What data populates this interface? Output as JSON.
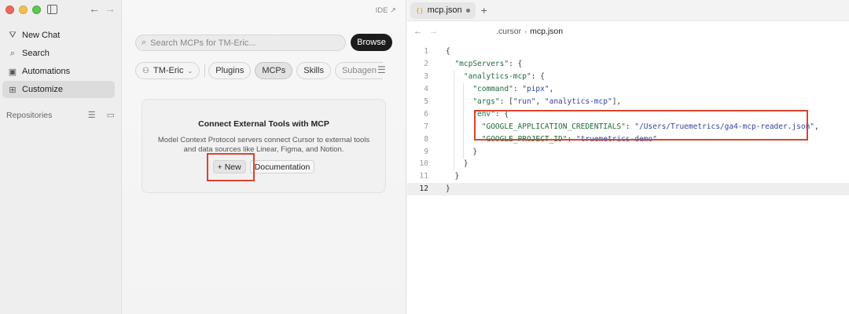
{
  "sidebar": {
    "items": [
      {
        "icon": "new-chat-icon",
        "glyph": "⛛",
        "label": "New Chat"
      },
      {
        "icon": "search-icon",
        "glyph": "⌕",
        "label": "Search"
      },
      {
        "icon": "automations-icon",
        "glyph": "▣",
        "label": "Automations"
      },
      {
        "icon": "customize-icon",
        "glyph": "⊞",
        "label": "Customize"
      }
    ],
    "active_index": 3,
    "repositories_label": "Repositories"
  },
  "middle": {
    "ide_label": "IDE ↗",
    "search_placeholder": "Search MCPs for TM-Eric...",
    "browse_label": "Browse",
    "filters": {
      "account": "TM-Eric",
      "tabs": [
        "Plugins",
        "MCPs",
        "Skills",
        "Subagen"
      ],
      "active_tab": "MCPs"
    },
    "card": {
      "title": "Connect External Tools with MCP",
      "description": "Model Context Protocol servers connect Cursor to external tools and data sources like Linear, Figma, and Notion.",
      "new_label": "+ New",
      "docs_label": "Documentation"
    }
  },
  "editor": {
    "tab_label": "mcp.json",
    "tab_icon": "{}",
    "breadcrumb": [
      ".cursor",
      "mcp.json"
    ],
    "current_line": 12,
    "lines": [
      "{",
      "  \"mcpServers\": {",
      "    \"analytics-mcp\": {",
      "      \"command\": \"pipx\",",
      "      \"args\": [\"run\", \"analytics-mcp\"],",
      "      \"env\": {",
      "        \"GOOGLE_APPLICATION_CREDENTIALS\": \"/Users/Truemetrics/ga4-mcp-reader.json\",",
      "        \"GOOGLE_PROJECT_ID\": \"truemetrics-demo\"",
      "      }",
      "    }",
      "  }",
      "}"
    ]
  },
  "colors": {
    "highlight_box": "#d9442e",
    "json_key": "#1f6b3a",
    "json_string": "#3344a0"
  }
}
